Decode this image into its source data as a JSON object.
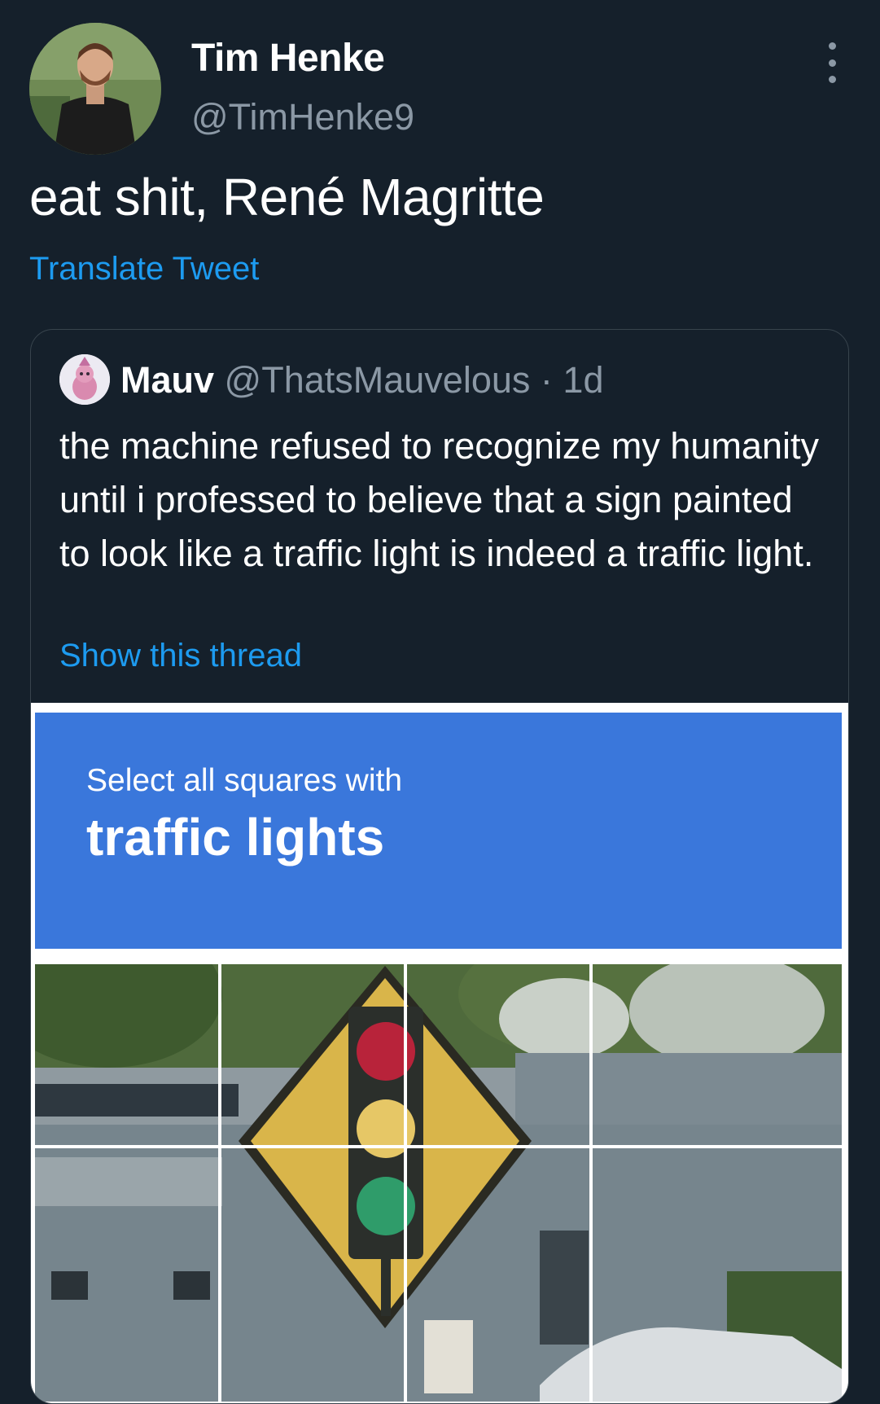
{
  "tweet": {
    "author_name": "Tim Henke",
    "author_handle": "@TimHenke9",
    "text": "eat shit, René Magritte",
    "translate_label": "Translate Tweet",
    "more_icon": "more-vertical-icon"
  },
  "quoted": {
    "name": "Mauv",
    "handle": "@ThatsMauvelous",
    "separator": "·",
    "time": "1d",
    "text": "the machine refused to recognize my humanity until i professed to believe that a sign painted to look like a traffic light is indeed a traffic light.",
    "show_thread_label": "Show this thread"
  },
  "captcha": {
    "instruction": "Select all squares with",
    "target": "traffic lights",
    "header_color": "#3a77db"
  },
  "colors": {
    "background": "#15202b",
    "link": "#1d9bf0",
    "secondary": "#8b98a5"
  }
}
